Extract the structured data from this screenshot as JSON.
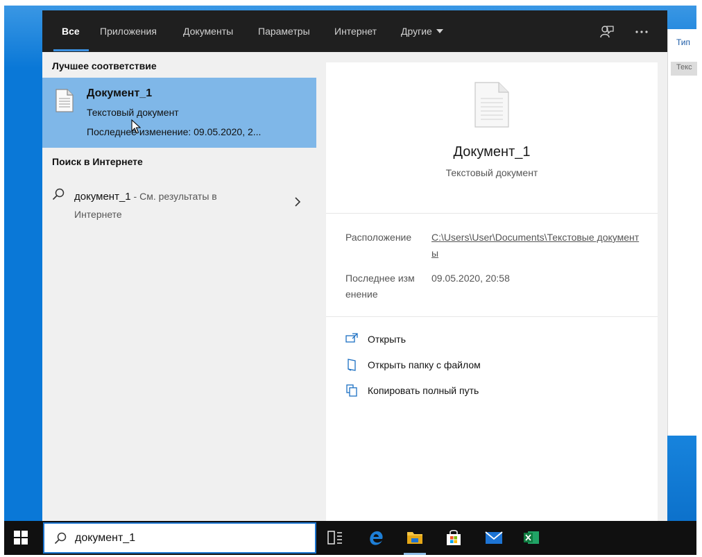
{
  "tabs": [
    {
      "label": "Все",
      "active": true
    },
    {
      "label": "Приложения"
    },
    {
      "label": "Документы"
    },
    {
      "label": "Параметры"
    },
    {
      "label": "Интернет"
    },
    {
      "label": "Другие"
    }
  ],
  "toolbar_icons": [
    "feedback-icon",
    "more-options-icon"
  ],
  "left": {
    "best_match_header": "Лучшее соответствие",
    "best_match": {
      "title": "Документ_1",
      "type": "Текстовый документ",
      "modified": "Последнее изменение: 09.05.2020, 2..."
    },
    "web_header": "Поиск в Интернете",
    "web_item": {
      "query": "документ_1",
      "hint": " - См. результаты в",
      "hint2": "Интернете"
    }
  },
  "preview": {
    "title": "Документ_1",
    "type": "Текстовый документ",
    "location_label": "Расположение",
    "location_value": "C:\\Users\\User\\Documents\\Текстовые документы",
    "modified_label": "Последнее изм енение",
    "modified_value": "09.05.2020, 20:58",
    "actions": [
      {
        "label": "Открыть",
        "icon": "open-icon"
      },
      {
        "label": "Открыть папку с файлом",
        "icon": "open-folder-icon"
      },
      {
        "label": "Копировать полный путь",
        "icon": "copy-path-icon"
      }
    ]
  },
  "background_window": {
    "column_header": "Тип",
    "row_text": "Текс"
  },
  "taskbar": {
    "search_value": "документ_1",
    "apps": [
      "task-view-icon",
      "edge-icon",
      "file-explorer-icon",
      "store-icon",
      "mail-icon",
      "excel-icon"
    ]
  },
  "colors": {
    "accent": "#3b8fe0",
    "selection": "#7fb7e8",
    "tab_bar": "#1f1f1f",
    "desktop": "#0a78d7"
  }
}
